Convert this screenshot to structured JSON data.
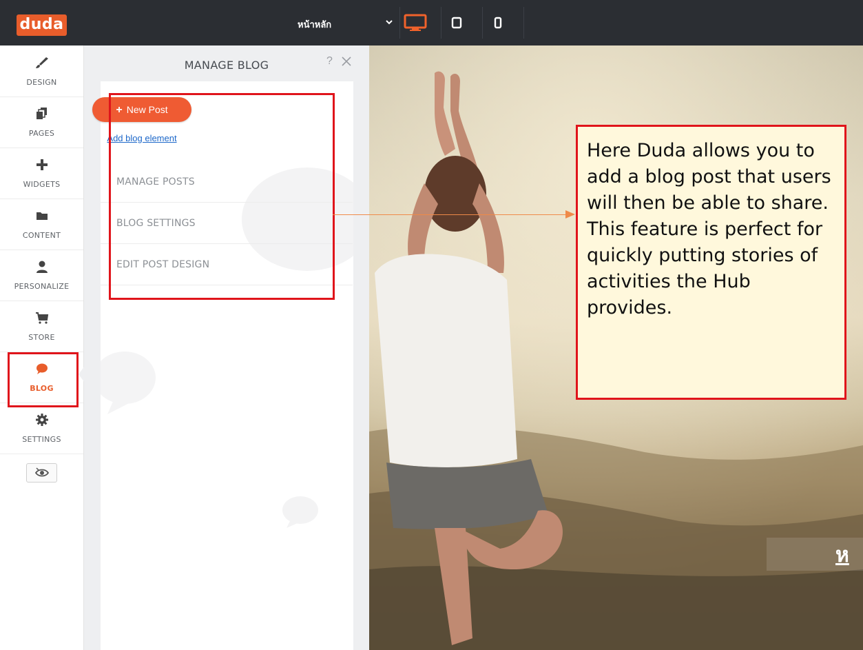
{
  "app": {
    "logo_text": "duda",
    "brand_color": "#e85d2b"
  },
  "topbar": {
    "page_selector": {
      "value": "หน้าหลัก"
    },
    "devices": [
      {
        "name": "desktop",
        "icon": "desktop-icon",
        "active": true,
        "active_color": "#f0622b"
      },
      {
        "name": "tablet",
        "icon": "tablet-icon",
        "active": false
      },
      {
        "name": "mobile",
        "icon": "mobile-icon",
        "active": false
      }
    ]
  },
  "sidebar": {
    "items": [
      {
        "label": "DESIGN",
        "icon": "brush-icon"
      },
      {
        "label": "PAGES",
        "icon": "pages-icon"
      },
      {
        "label": "WIDGETS",
        "icon": "plus-icon"
      },
      {
        "label": "CONTENT",
        "icon": "folder-icon"
      },
      {
        "label": "PERSONALIZE",
        "icon": "person-icon"
      },
      {
        "label": "STORE",
        "icon": "cart-icon"
      },
      {
        "label": "BLOG",
        "icon": "chat-bubble-icon",
        "active": true
      },
      {
        "label": "SETTINGS",
        "icon": "gear-icon"
      }
    ],
    "preview_icon": "eye-icon"
  },
  "panel": {
    "title": "MANAGE BLOG",
    "help": "?",
    "new_post_label": "New Post",
    "add_blog_element": "Add blog element",
    "menu": [
      {
        "label": "MANAGE POSTS"
      },
      {
        "label": "BLOG SETTINGS"
      },
      {
        "label": "EDIT POST DESIGN"
      }
    ]
  },
  "hero": {
    "text": "ห"
  },
  "callout": {
    "text": "Here Duda allows you to add a blog post that users will then be able to share. This feature is perfect for quickly putting stories of activities the Hub provides.",
    "border_color": "#e0141b",
    "background": "#fff8dc"
  }
}
